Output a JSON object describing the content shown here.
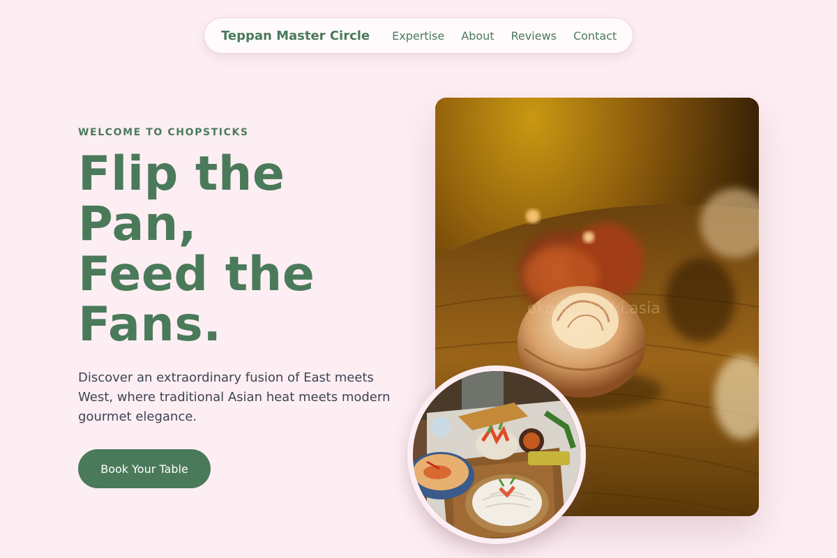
{
  "nav": {
    "brand": "Teppan Master Circle",
    "links": [
      "Expertise",
      "About",
      "Reviews",
      "Contact"
    ]
  },
  "hero": {
    "eyebrow": "WELCOME TO CHOPSTICKS",
    "headline_lines": [
      "Flip the",
      "Pan,",
      "Feed the",
      "Fans."
    ],
    "description": "Discover an extraordinary fusion of East meets West, where traditional Asian heat meets modern gourmet elegance.",
    "cta_label": "Book Your Table"
  },
  "images": {
    "main_photo_watermark": "okonomiyaki.asia"
  },
  "colors": {
    "background": "#fdeef3",
    "accent_green": "#4a7a5a",
    "body_text": "#3d4452"
  }
}
